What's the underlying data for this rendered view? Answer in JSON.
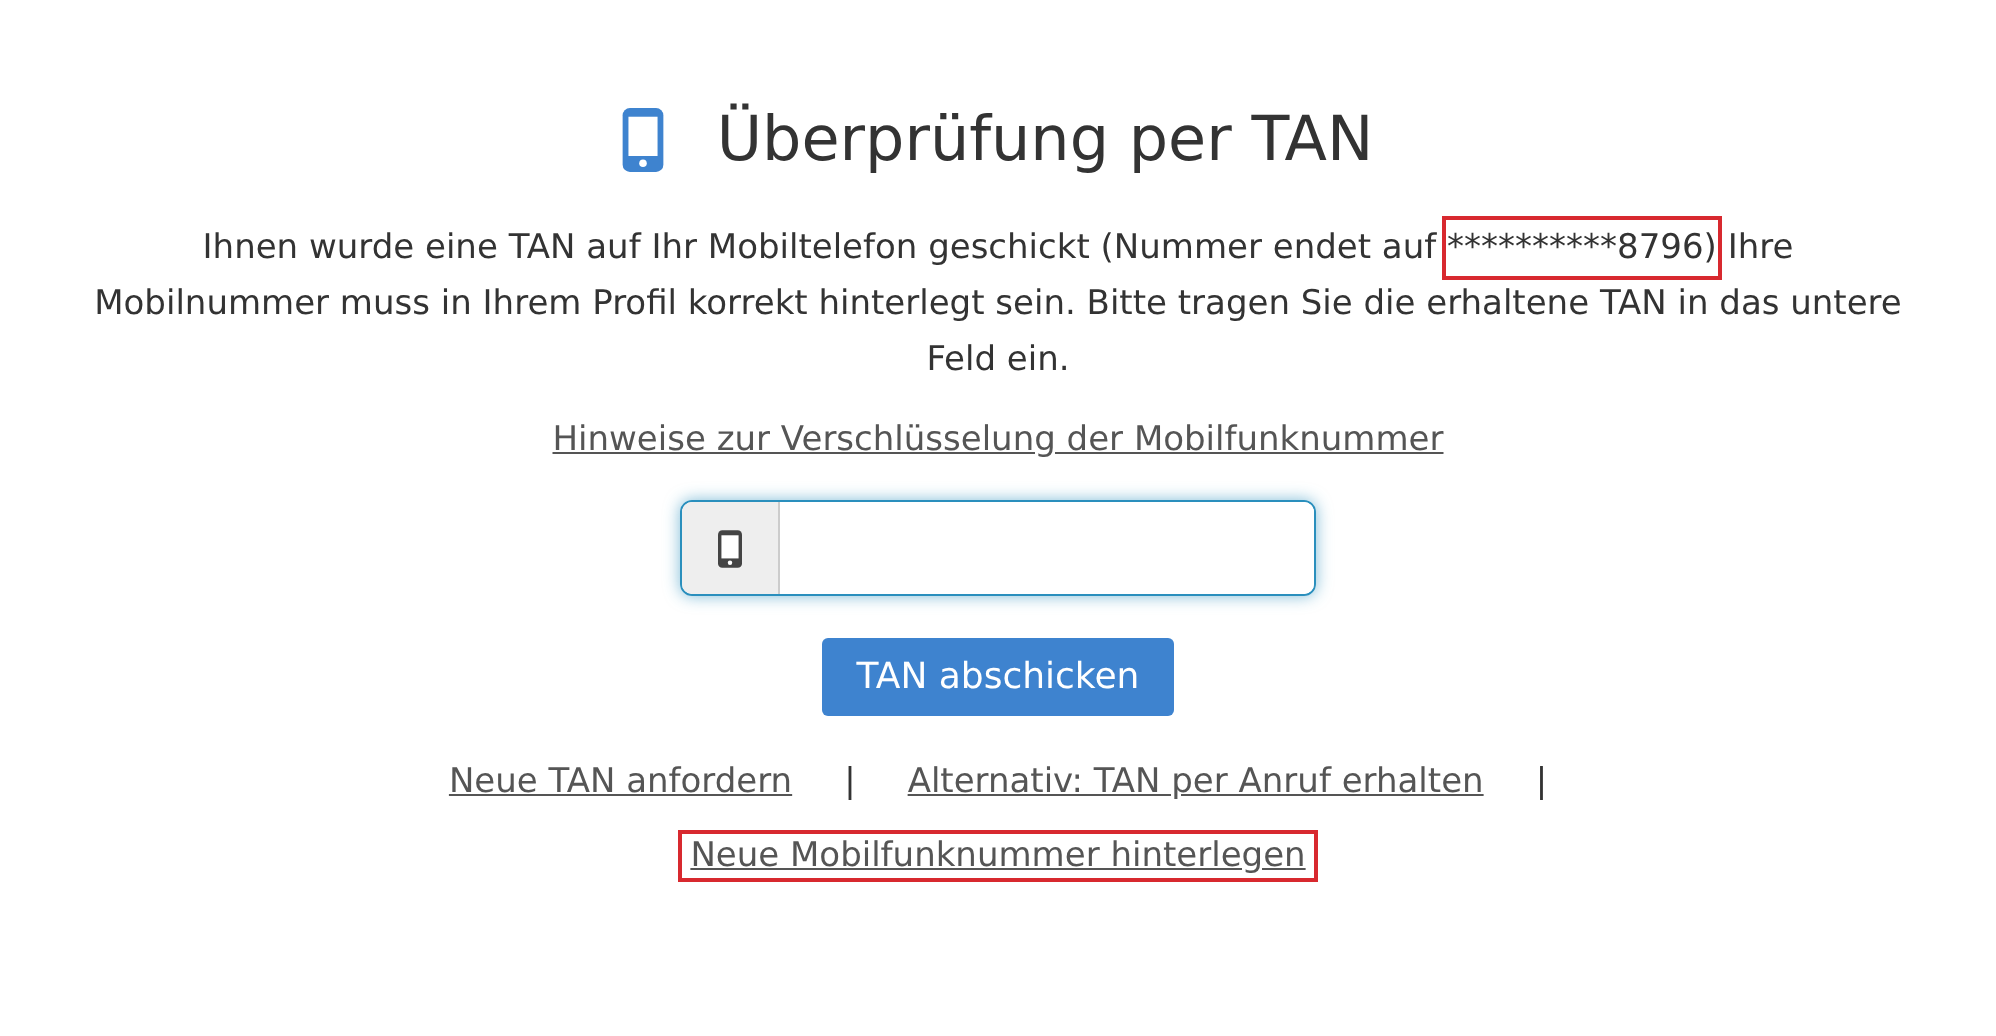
{
  "heading": {
    "title": "Überprüfung per TAN"
  },
  "message": {
    "before": "Ihnen wurde eine TAN auf Ihr Mobiltelefon geschickt (Nummer endet auf ",
    "highlighted": "**********8796)",
    "after": " Ihre Mobilnummer muss in Ihrem Profil korrekt hinterlegt sein. Bitte tragen Sie die erhaltene TAN in das untere Feld ein."
  },
  "info_link": "Hinweise zur Verschlüsselung der Mobilfunknummer",
  "tan_field": {
    "focused": true
  },
  "submit_button": "TAN abschicken",
  "link_rows": [
    [
      {
        "kind": "link",
        "label": "Neue TAN anfordern",
        "highlighted": false
      },
      {
        "kind": "separator",
        "label": "|"
      },
      {
        "kind": "link",
        "label": "Alternativ: TAN per Anruf erhalten",
        "highlighted": false
      },
      {
        "kind": "separator",
        "label": "|"
      }
    ],
    [
      {
        "kind": "link",
        "label": "Neue Mobilfunknummer hinterlegen",
        "highlighted": true
      }
    ]
  ]
}
